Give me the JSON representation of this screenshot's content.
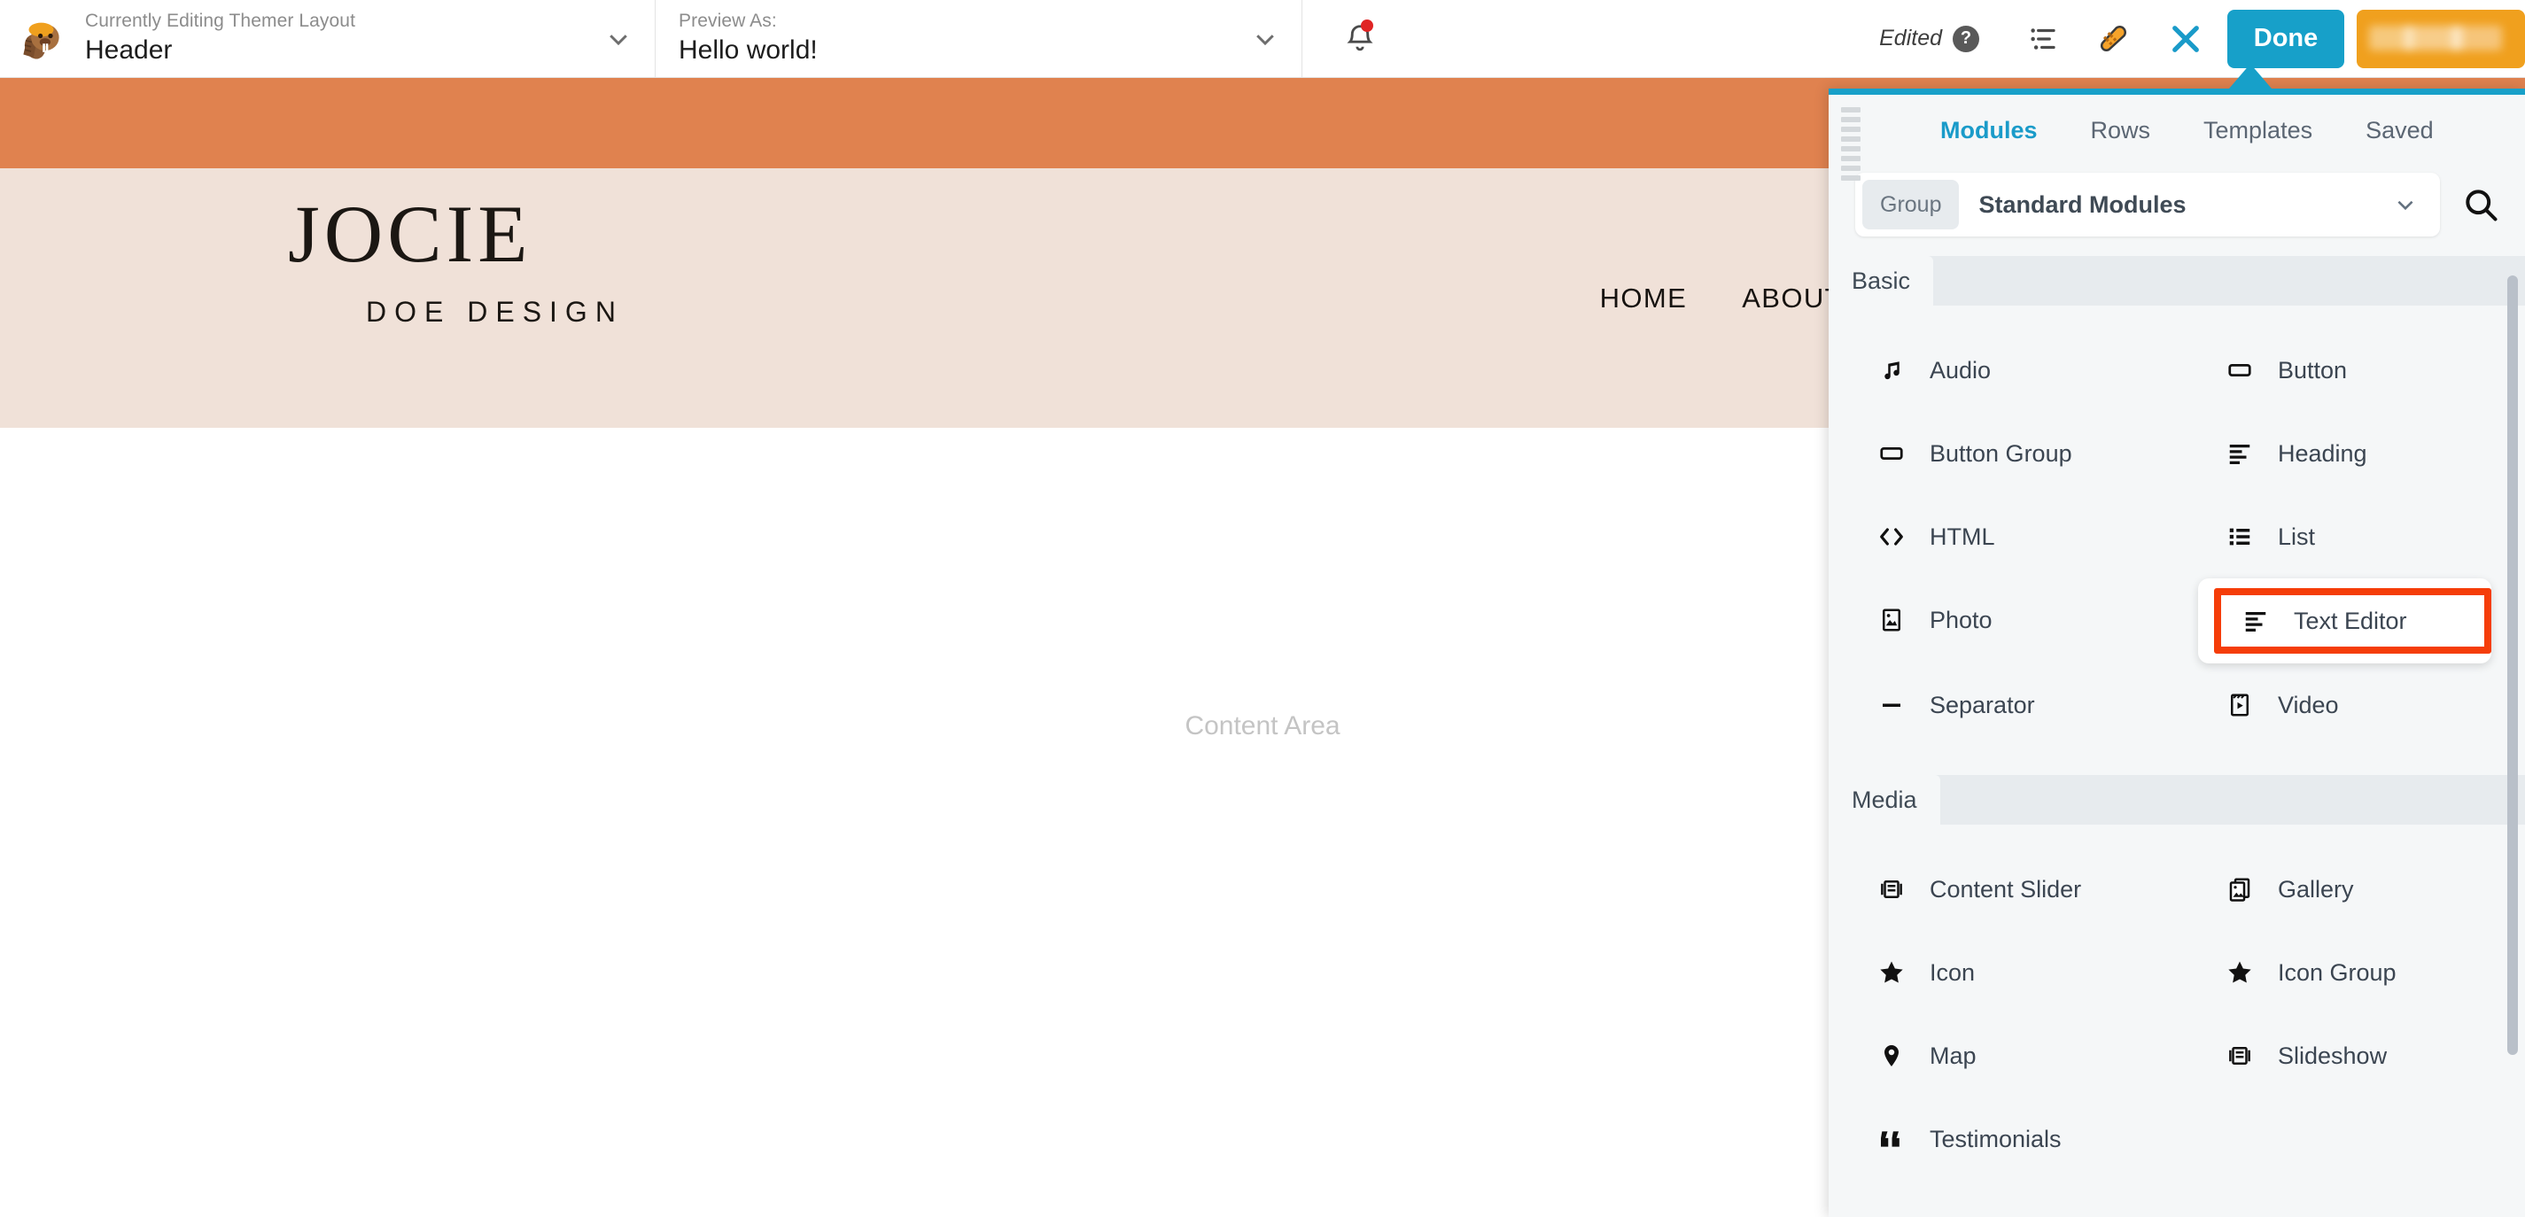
{
  "colors": {
    "accent_blue": "#17a0c9",
    "orange_band": "#e0824f",
    "header_beige": "#f0e1d8",
    "highlight_red": "#f53d09",
    "account_orange": "#f0a01e",
    "notification_red": "#e02424"
  },
  "adminbar": {
    "editing": {
      "kicker": "Currently Editing Themer Layout",
      "value": "Header",
      "chevron_icon": "chevron-down-icon"
    },
    "preview": {
      "kicker": "Preview As:",
      "value": "Hello world!",
      "chevron_icon": "chevron-down-icon"
    },
    "bell_icon": "notification-bell-icon",
    "edited_label": "Edited",
    "help_icon": "help-question-icon",
    "outline_icon": "outline-list-icon",
    "tools_icon": "tools-trowel-icon",
    "close_icon": "close-x-icon",
    "done_label": "Done",
    "account_label": ""
  },
  "site": {
    "brand_main": "JOCIE",
    "brand_sub": "DOE DESIGN",
    "nav": [
      {
        "label": "HOME"
      },
      {
        "label": "ABOUT"
      }
    ],
    "content_area_label": "Content Area"
  },
  "panel": {
    "drag_handle_icon": "drag-handle-icon",
    "tabs": [
      {
        "label": "Modules",
        "active": true
      },
      {
        "label": "Rows",
        "active": false
      },
      {
        "label": "Templates",
        "active": false
      },
      {
        "label": "Saved",
        "active": false
      }
    ],
    "group": {
      "label": "Group",
      "selected": "Standard Modules",
      "chevron_icon": "chevron-down-icon",
      "search_icon": "search-icon"
    },
    "sections": [
      {
        "title": "Basic",
        "modules": [
          {
            "label": "Audio",
            "icon": "music-note-icon",
            "highlighted": false
          },
          {
            "label": "Button",
            "icon": "button-rect-icon",
            "highlighted": false
          },
          {
            "label": "Button Group",
            "icon": "button-rect-icon",
            "highlighted": false
          },
          {
            "label": "Heading",
            "icon": "heading-lines-icon",
            "highlighted": false
          },
          {
            "label": "HTML",
            "icon": "code-brackets-icon",
            "highlighted": false
          },
          {
            "label": "List",
            "icon": "bullet-list-icon",
            "highlighted": false
          },
          {
            "label": "Photo",
            "icon": "photo-icon",
            "highlighted": false
          },
          {
            "label": "Text Editor",
            "icon": "text-lines-icon",
            "highlighted": true
          },
          {
            "label": "Separator",
            "icon": "separator-dash-icon",
            "highlighted": false
          },
          {
            "label": "Video",
            "icon": "video-clapper-icon",
            "highlighted": false
          }
        ]
      },
      {
        "title": "Media",
        "modules": [
          {
            "label": "Content Slider",
            "icon": "content-slider-icon",
            "highlighted": false
          },
          {
            "label": "Gallery",
            "icon": "gallery-stack-icon",
            "highlighted": false
          },
          {
            "label": "Icon",
            "icon": "star-icon",
            "highlighted": false
          },
          {
            "label": "Icon Group",
            "icon": "star-icon",
            "highlighted": false
          },
          {
            "label": "Map",
            "icon": "map-pin-icon",
            "highlighted": false
          },
          {
            "label": "Slideshow",
            "icon": "content-slider-icon",
            "highlighted": false
          },
          {
            "label": "Testimonials",
            "icon": "quote-marks-icon",
            "highlighted": false
          }
        ]
      }
    ]
  }
}
